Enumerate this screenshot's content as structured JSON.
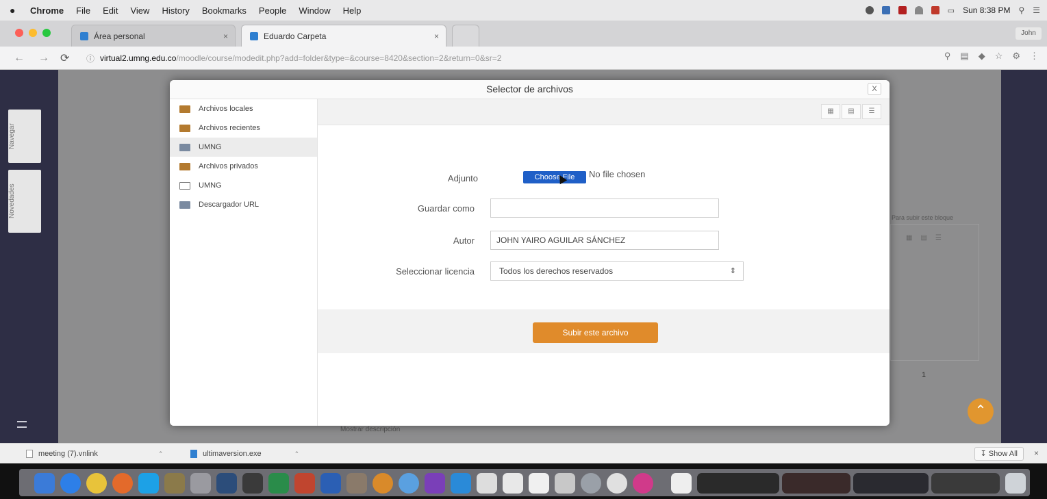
{
  "menubar": {
    "apple": "",
    "items": [
      "Chrome",
      "File",
      "Edit",
      "View",
      "History",
      "Bookmarks",
      "People",
      "Window",
      "Help"
    ],
    "clock": "Sun 8:38 PM"
  },
  "tabs": [
    {
      "label": "Área personal"
    },
    {
      "label": "Eduardo Carpeta"
    }
  ],
  "profile": "John",
  "address": {
    "host": "virtual2.umng.edu.co",
    "path": "/moodle/course/modedit.php?add=folder&type=&course=8420&section=2&return=0&sr=2"
  },
  "left_tabs": [
    "Navegar",
    "Novedades"
  ],
  "dialog": {
    "title": "Selector de archivos",
    "close": "X",
    "repositories": [
      {
        "label": "Archivos locales",
        "icon": "folder-icon"
      },
      {
        "label": "Archivos recientes",
        "icon": "folder-icon"
      },
      {
        "label": "UMNG",
        "icon": "repo-icon"
      },
      {
        "label": "Archivos privados",
        "icon": "folder-icon"
      },
      {
        "label": "UMNG",
        "icon": "box-icon"
      },
      {
        "label": "Descargador URL",
        "icon": "repo-icon"
      }
    ],
    "form": {
      "attach_label": "Adjunto",
      "choose_button": "Choose File",
      "no_file": "No file chosen",
      "save_as_label": "Guardar como",
      "save_as_value": "",
      "author_label": "Autor",
      "author_value": "JOHN YAIRO AGUILAR SÁNCHEZ",
      "license_label": "Seleccionar licencia",
      "license_value": "Todos los derechos reservados",
      "upload_button": "Subir este archivo"
    }
  },
  "background": {
    "panel_label": "Para subir este bloque",
    "num": "1",
    "text": "Mostrar descripción"
  },
  "downloads": [
    {
      "name": "meeting (7).vnlink"
    },
    {
      "name": "ultimaversion.exe"
    }
  ],
  "show_all": "Show All",
  "colors": {
    "dialog_upload": "#e08b2b",
    "choose_button": "#1f5fc7",
    "sidebar_strip": "#2e2e45"
  }
}
